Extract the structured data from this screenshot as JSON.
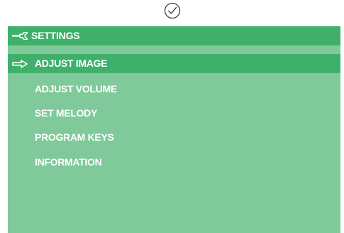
{
  "status_icon": "checkmark-circle-icon",
  "header": {
    "icon": "wrench-icon",
    "title": "SETTINGS"
  },
  "menu": {
    "selected_index": 0,
    "pointer_icon": "arrow-right-icon",
    "items": [
      {
        "label": "ADJUST IMAGE"
      },
      {
        "label": "ADJUST VOLUME"
      },
      {
        "label": "SET MELODY"
      },
      {
        "label": "PROGRAM KEYS"
      },
      {
        "label": "INFORMATION"
      }
    ]
  },
  "colors": {
    "panel": "#80c99a",
    "header": "#3fb06a",
    "highlight": "#3fb06a",
    "text": "#ffffff"
  }
}
